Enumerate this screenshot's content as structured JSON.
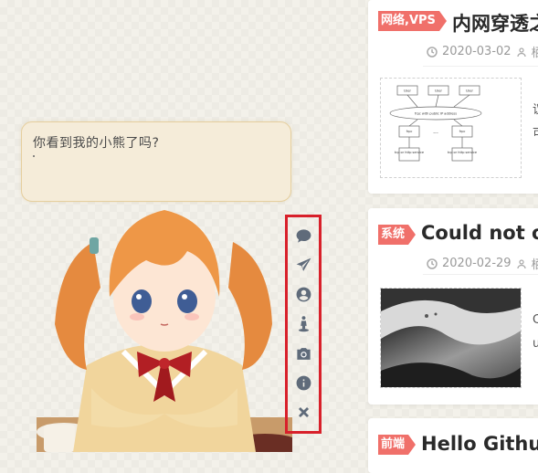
{
  "bubble": {
    "message": "你看到我的小熊了吗?"
  },
  "toolbar": {
    "items": [
      {
        "icon": "comment-icon"
      },
      {
        "icon": "paper-plane-icon"
      },
      {
        "icon": "user-circle-icon"
      },
      {
        "icon": "street-view-icon"
      },
      {
        "icon": "camera-icon"
      },
      {
        "icon": "info-circle-icon"
      },
      {
        "icon": "close-icon"
      }
    ],
    "highlight_color": "#d8202a"
  },
  "posts": [
    {
      "tag": "网络,VPS",
      "title": "内网穿透之",
      "date": "2020-03-02",
      "author": "栖",
      "excerpt": [
        "议",
        "可"
      ]
    },
    {
      "tag": "系统",
      "title": "Could not o",
      "date": "2020-02-29",
      "author": "栖",
      "excerpt": [
        "C",
        "u"
      ]
    },
    {
      "tag": "前端",
      "title": "Hello Githul"
    }
  ],
  "diagram": {
    "boxes": [
      "User",
      "User",
      "User",
      "frpc with public IP address",
      "frpc",
      "frpc",
      "tcp or http service",
      "tcp or http service",
      "..."
    ]
  },
  "accent_color": "#f0706a"
}
